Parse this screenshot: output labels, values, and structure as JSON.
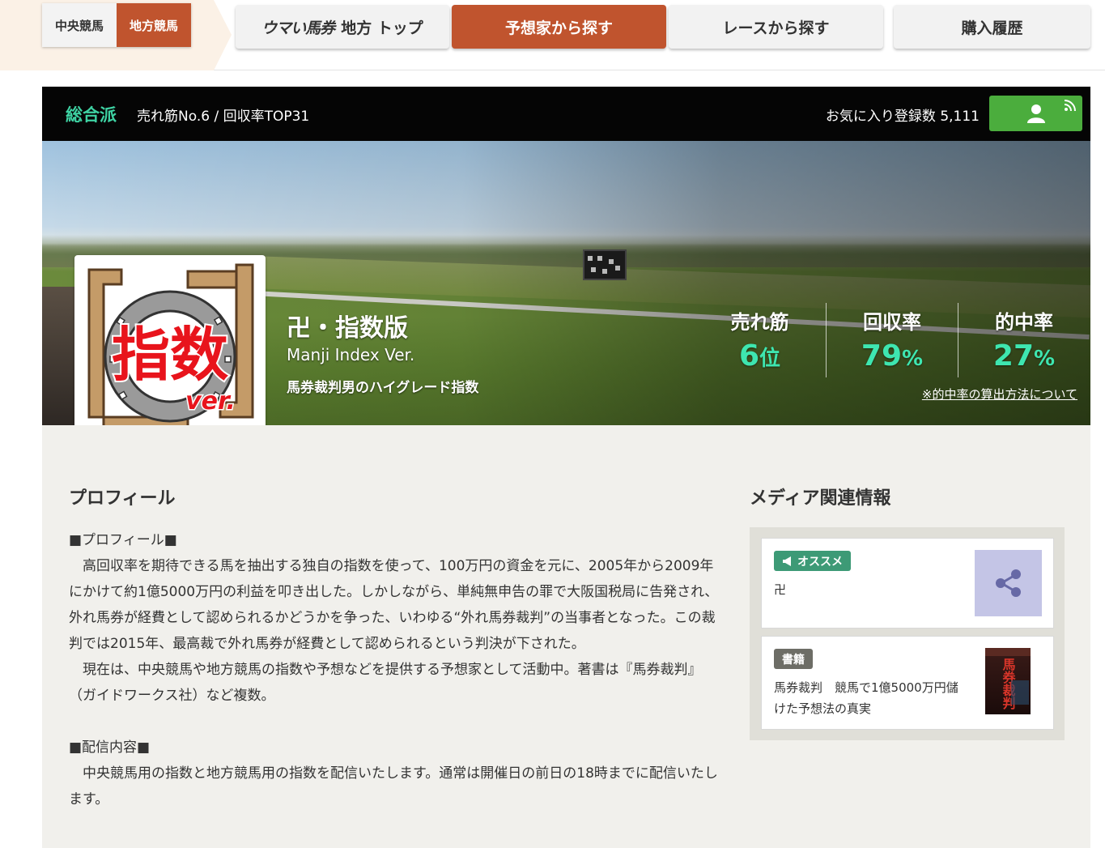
{
  "nav": {
    "central_label": "中央競馬",
    "local_label": "地方競馬",
    "logo_text": "ウマい馬券",
    "top_label": "地方 トップ",
    "search_by_predictor": "予想家から探す",
    "search_by_race": "レースから探す",
    "history": "購入履歴"
  },
  "header": {
    "category": "総合派",
    "rank_info": "売れ筋No.6 / 回収率TOP31",
    "favorites": "お気に入り登録数 5,111"
  },
  "predictor": {
    "name": "卍・指数版",
    "english_name": "Manji Index Ver.",
    "tagline": "馬券裁判男のハイグレード指数",
    "stats": [
      {
        "label": "売れ筋",
        "value": "6",
        "unit": "位"
      },
      {
        "label": "回収率",
        "value": "79",
        "unit": "%"
      },
      {
        "label": "的中率",
        "value": "27",
        "unit": "%"
      }
    ],
    "method_link": "※的中率の算出方法について",
    "avatar_text": "指数",
    "avatar_sub": "ver."
  },
  "profile": {
    "heading": "プロフィール",
    "paragraphs": [
      "■プロフィール■",
      "　高回収率を期待できる馬を抽出する独自の指数を使って、100万円の資金を元に、2005年から2009年にかけて約1億5000万円の利益を叩き出した。しかしながら、単純無申告の罪で大阪国税局に告発され、外れ馬券が経費として認められるかどうかを争った、いわゆる“外れ馬券裁判”の当事者となった。この裁判では2015年、最高裁で外れ馬券が経費として認められるという判決が下された。",
      "　現在は、中央競馬や地方競馬の指数や予想などを提供する予想家として活動中。著書は『馬券裁判』（ガイドワークス社）など複数。",
      "",
      "■配信内容■",
      "　中央競馬用の指数と地方競馬用の指数を配信いたします。通常は開催日の前日の18時までに配信いたします。"
    ]
  },
  "media": {
    "heading": "メディア関連情報",
    "items": [
      {
        "badge": "オススメ",
        "text": "卍"
      },
      {
        "badge": "書籍",
        "text": "馬券裁判　競馬で1億5000万円儲けた予想法の真実"
      }
    ],
    "book_title": "馬券裁判"
  },
  "colors": {
    "accent": "#c0542e",
    "stat_green": "#3ee6b0",
    "category_green": "#3ed2a3",
    "fav_button": "#4bad3d"
  }
}
